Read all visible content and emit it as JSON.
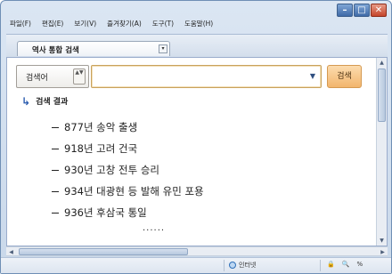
{
  "menubar": {
    "items": [
      "파일(F)",
      "편집(E)",
      "보기(V)",
      "즐겨찾기(A)",
      "도구(T)",
      "도움말(H)"
    ]
  },
  "tab": {
    "label": "역사 통합 검색",
    "dropdown_glyph": "▾"
  },
  "search": {
    "field_label": "검색어",
    "spin_glyph": "▲▼",
    "input_value": "",
    "dropdown_glyph": "▼",
    "button_label": "검색"
  },
  "results": {
    "heading": "검색 결과",
    "items": [
      "877년 송악 출생",
      "918년 고려 건국",
      "930년 고창 전투 승리",
      "934년 대광현 등 발해 유민 포용",
      "936년 후삼국 통일"
    ],
    "more": "......"
  },
  "statusbar": {
    "zone_label": "인터넷",
    "zoom_glyph": "🔍",
    "zoom_label": "%",
    "security_glyph": "🔒"
  },
  "colors": {
    "window_frame": "#c9d8ea",
    "accent_blue": "#2f5fb0",
    "search_button": "#f2b56d",
    "input_border": "#c9a25c"
  }
}
